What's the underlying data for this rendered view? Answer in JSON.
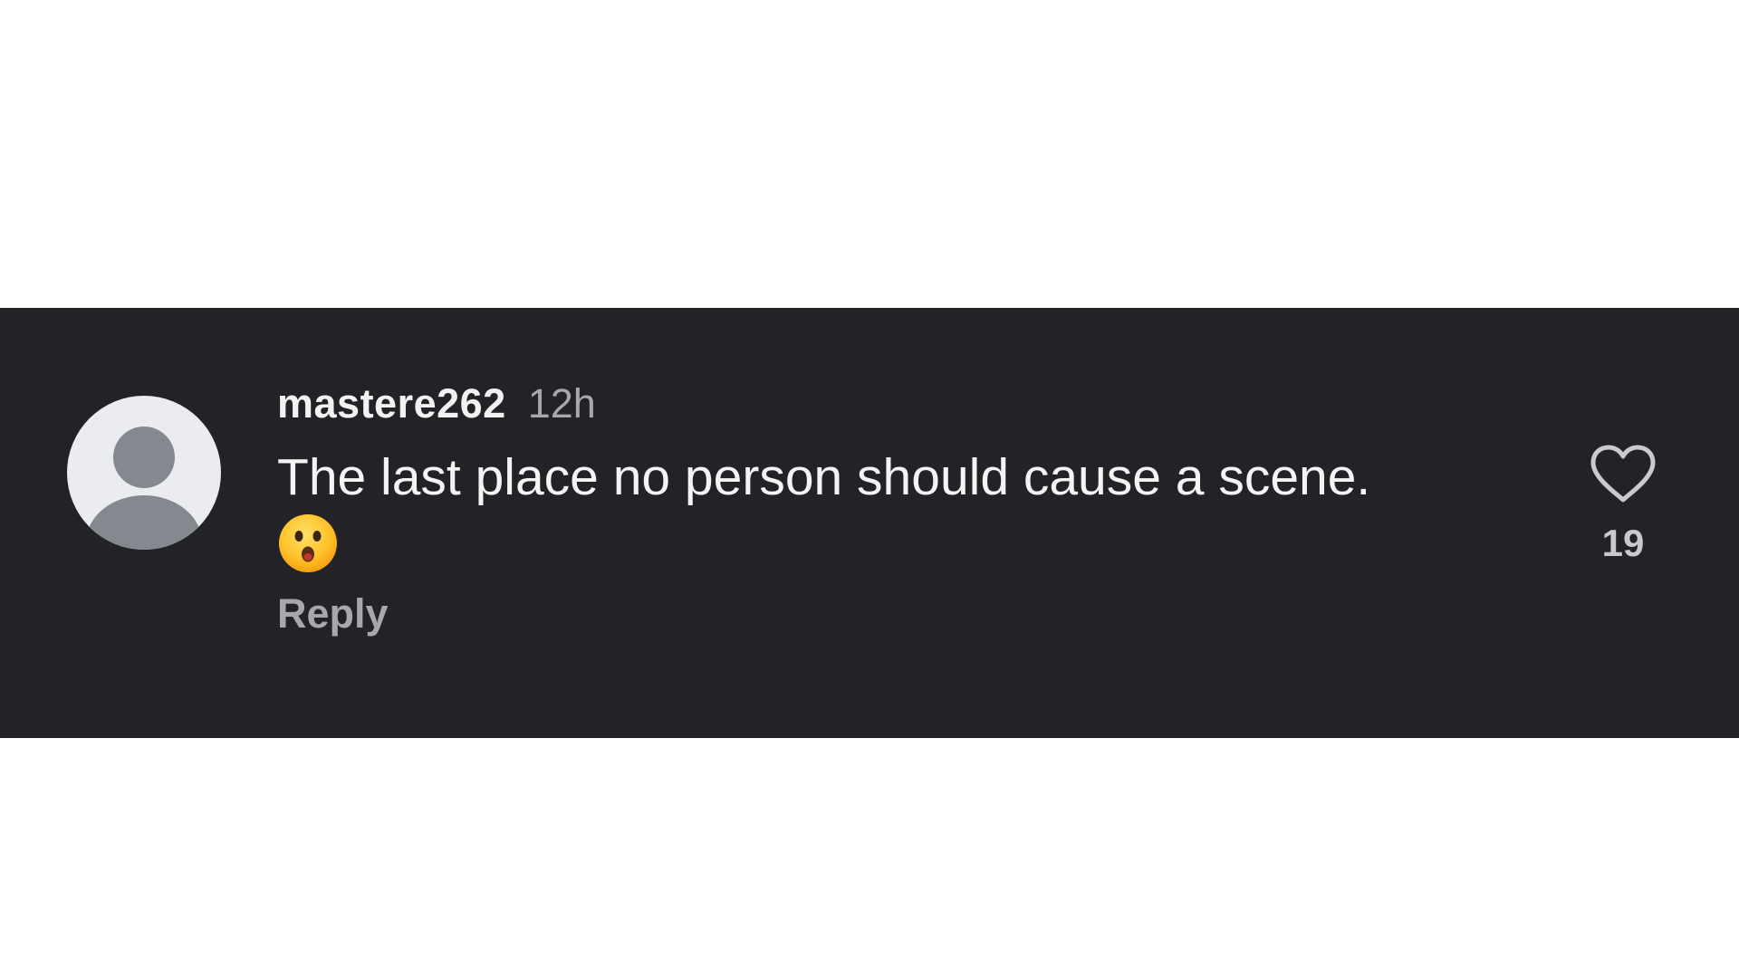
{
  "comment": {
    "username": "mastere262",
    "timestamp": "12h",
    "text": "The last place no person should cause a scene.",
    "emoji": "astonished-face",
    "reply_label": "Reply",
    "like_count": "19"
  },
  "icons": {
    "avatar": "default-user-avatar",
    "like": "heart-outline-icon"
  },
  "colors": {
    "band_background": "#222327",
    "primary_text": "#f4f4f5",
    "secondary_text": "#a6a8ad",
    "avatar_background": "#ebecf0",
    "avatar_figure": "#86888f"
  }
}
